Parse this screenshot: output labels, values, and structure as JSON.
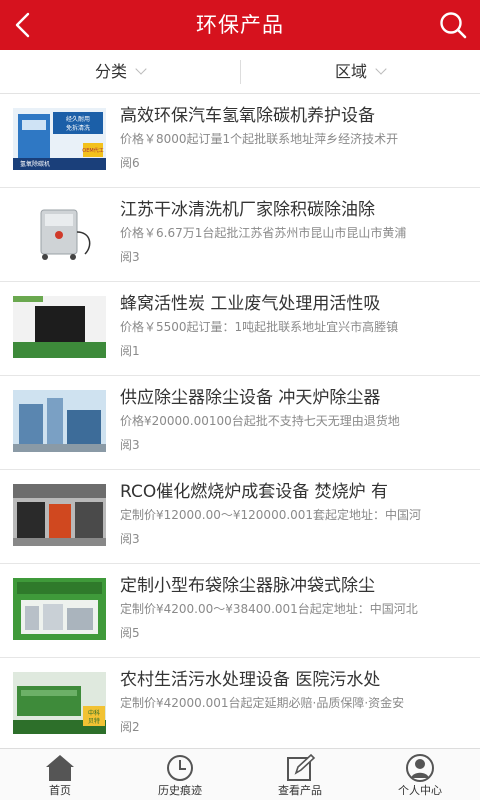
{
  "header": {
    "title": "环保产品"
  },
  "filter": {
    "category_label": "分类",
    "region_label": "区域"
  },
  "products": [
    {
      "name": "高效环保汽车氢氧除碳机养护设备",
      "info": "价格￥8000起订量1个起批联系地址萍乡经济技术开",
      "views": "阅6",
      "thumb_text": [
        "经久耐用",
        "免拆清洗",
        "氢氧除碳机",
        "OEM代工"
      ]
    },
    {
      "name": "江苏干冰清洗机厂家除积碳除油除",
      "info": "价格￥6.67万1台起批江苏省苏州市昆山市昆山市黄浦",
      "views": "阅3",
      "thumb_text": []
    },
    {
      "name": "蜂窝活性炭 工业废气处理用活性吸",
      "info": "价格￥5500起订量：1吨起批联系地址宜兴市高塍镇",
      "views": "阅1",
      "thumb_text": []
    },
    {
      "name": "供应除尘器除尘设备 冲天炉除尘器",
      "info": "价格¥20000.00100台起批不支持七天无理由退货地",
      "views": "阅3",
      "thumb_text": []
    },
    {
      "name": "RCO催化燃烧炉成套设备 焚烧炉 有",
      "info": "定制价¥12000.00～¥120000.001套起定地址：中国河",
      "views": "阅3",
      "thumb_text": []
    },
    {
      "name": "定制小型布袋除尘器脉冲袋式除尘",
      "info": "定制价¥4200.00～¥38400.001台起定地址：中国河北",
      "views": "阅5",
      "thumb_text": []
    },
    {
      "name": "农村生活污水处理设备 医院污水处",
      "info": "定制价¥42000.001台起定延期必赔·品质保障·资金安",
      "views": "阅2",
      "thumb_text": [
        "中科",
        "贝特"
      ]
    }
  ],
  "tabbar": {
    "items": [
      {
        "label": "首页",
        "icon": "home-icon"
      },
      {
        "label": "历史痕迹",
        "icon": "clock-icon"
      },
      {
        "label": "查看产品",
        "icon": "edit-icon"
      },
      {
        "label": "个人中心",
        "icon": "user-icon"
      }
    ]
  },
  "colors": {
    "brand": "#d6121e"
  }
}
